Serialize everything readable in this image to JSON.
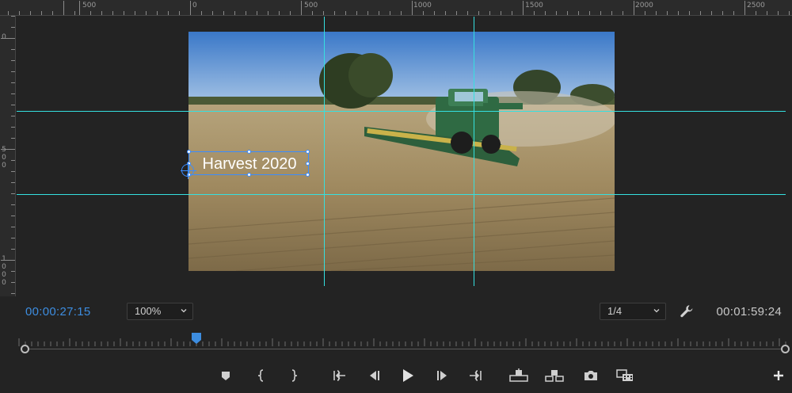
{
  "ruler_top": {
    "labels": [
      "500",
      "0",
      "500",
      "1000",
      "1500",
      "2000",
      "2500"
    ]
  },
  "ruler_left": {
    "labels": [
      "0",
      "5\n0\n0",
      "1\n0\n0\n0"
    ]
  },
  "title_overlay": {
    "text": "Harvest 2020"
  },
  "timecode": {
    "current": "00:00:27:15",
    "duration": "00:01:59:24"
  },
  "zoom_select": {
    "value": "100%"
  },
  "resolution_select": {
    "value": "1/4"
  },
  "controls": {
    "items": [
      "add-marker",
      "mark-in",
      "mark-out",
      "go-to-in",
      "step-back",
      "play",
      "step-forward",
      "go-to-out",
      "lift",
      "extract",
      "export-frame",
      "comparison-view",
      "button-editor"
    ]
  },
  "colors": {
    "background": "#232323",
    "accent_timecode": "#3d8de0",
    "guides": "#35e0e0",
    "selection": "#3a8cff"
  }
}
